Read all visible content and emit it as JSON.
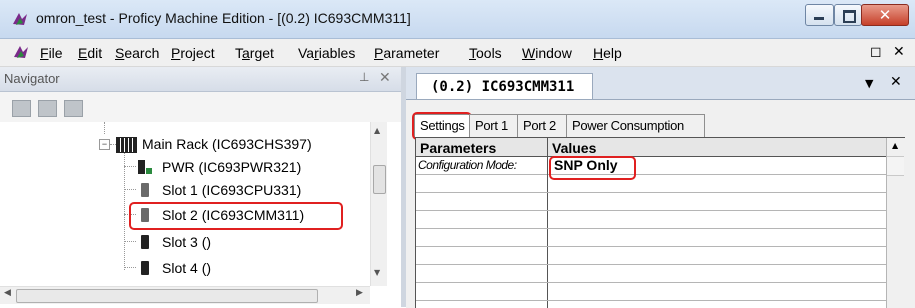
{
  "window": {
    "title": "omron_test - Proficy Machine Edition - [(0.2) IC693CMM311]",
    "minimize_glyph": "",
    "maximize_glyph": "",
    "close_glyph": "✕"
  },
  "menu": {
    "items": [
      {
        "pre": "",
        "key": "F",
        "post": "ile"
      },
      {
        "pre": "",
        "key": "E",
        "post": "dit"
      },
      {
        "pre": "",
        "key": "S",
        "post": "earch"
      },
      {
        "pre": "",
        "key": "P",
        "post": "roject"
      },
      {
        "pre": "T",
        "key": "a",
        "post": "rget"
      },
      {
        "pre": "Va",
        "key": "r",
        "post": "iables"
      },
      {
        "pre": "",
        "key": "P",
        "post": "arameter"
      },
      {
        "pre": "",
        "key": "T",
        "post": "ools"
      },
      {
        "pre": "",
        "key": "W",
        "post": "indow"
      },
      {
        "pre": "",
        "key": "H",
        "post": "elp"
      }
    ],
    "mdi_restore": "◻",
    "mdi_close": "✕"
  },
  "navigator": {
    "title": "Navigator",
    "pin": "⊥",
    "close": "✕",
    "tree": {
      "rack": "Main Rack (IC693CHS397)",
      "expander": "−",
      "slots": [
        {
          "label": "PWR (IC693PWR321)",
          "icon": "power-module-icon"
        },
        {
          "label": "Slot 1 (IC693CPU331)",
          "icon": "cpu-module-icon"
        },
        {
          "label": "Slot 2 (IC693CMM311)",
          "icon": "comm-module-icon"
        },
        {
          "label": "Slot 3 ()",
          "icon": "empty-slot-icon"
        },
        {
          "label": "Slot 4 ()",
          "icon": "empty-slot-icon"
        }
      ]
    },
    "scroll_up": "▲",
    "scroll_down": "▼",
    "scroll_left": "◀",
    "scroll_right": "▶"
  },
  "document": {
    "tab_label": "(0.2) IC693CMM311",
    "dropdown": "▼",
    "close": "✕",
    "property_tabs": [
      "Settings",
      "Port 1",
      "Port 2",
      "Power Consumption"
    ],
    "grid": {
      "headers": {
        "parameters": "Parameters",
        "values": "Values"
      },
      "rows": [
        {
          "parameter": "Configuration Mode:",
          "value": "SNP Only"
        }
      ],
      "scroll_up": "▲"
    }
  },
  "colors": {
    "highlight_box": "#e02020",
    "title_bar": "#c7d9ef"
  }
}
